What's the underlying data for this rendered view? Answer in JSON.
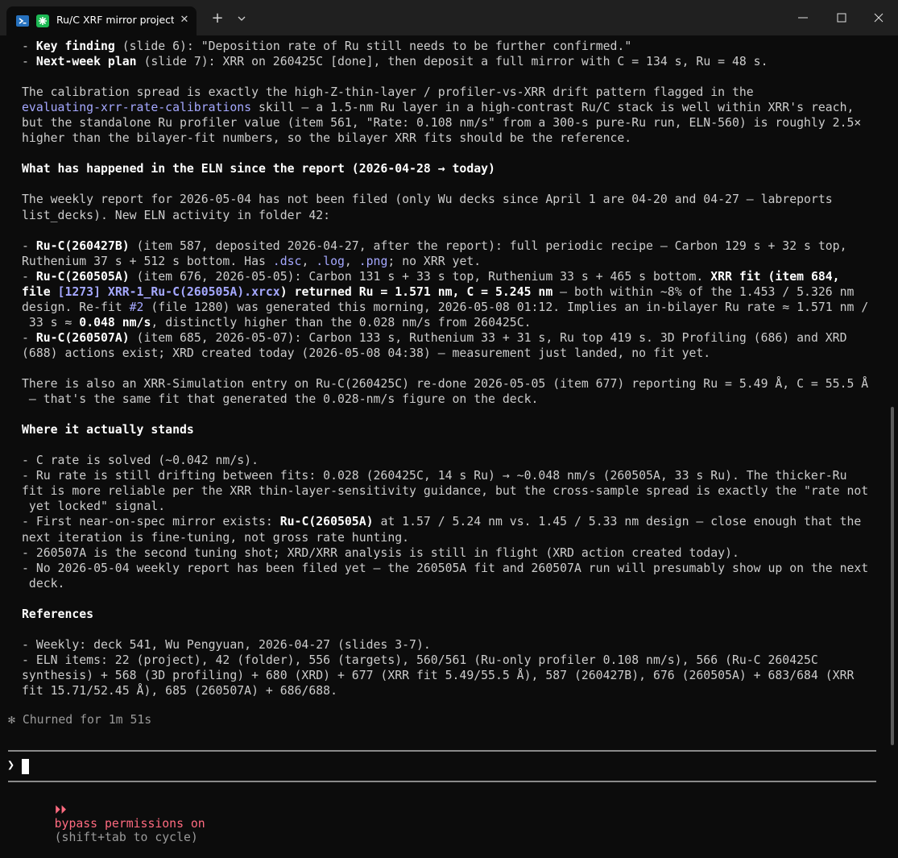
{
  "tab": {
    "title": "Ru/C XRF mirror project st",
    "close": "✕",
    "new_tab": "+"
  },
  "lines": [
    [
      [
        "- ",
        ""
      ],
      [
        "Key finding",
        "b"
      ],
      [
        " (slide 6): \"Deposition rate of Ru still needs to be further confirmed.\"",
        ""
      ]
    ],
    [
      [
        "- ",
        ""
      ],
      [
        "Next-week plan",
        "b"
      ],
      [
        " (slide 7): XRR on 260425C [done], then deposit a full mirror with C = 134 s, Ru = 48 s.",
        ""
      ]
    ],
    [],
    [
      [
        "The calibration spread is exactly the high-Z-thin-layer / profiler-vs-XRR drift pattern flagged in the",
        ""
      ]
    ],
    [
      [
        "evaluating-xrr-rate-calibrations",
        "link"
      ],
      [
        " skill — a 1.5-nm Ru layer in a high-contrast Ru/C stack is well within XRR's reach,",
        ""
      ]
    ],
    [
      [
        "but the standalone Ru profiler value (item 561, \"Rate: 0.108 nm/s\" from a 300-s pure-Ru run, ELN-560) is roughly 2.5×",
        ""
      ]
    ],
    [
      [
        "higher than the bilayer-fit numbers, so the bilayer XRR fits should be the reference.",
        ""
      ]
    ],
    [],
    [
      [
        "What has happened in the ELN since the report (2026-04-28 → today)",
        "b"
      ]
    ],
    [],
    [
      [
        "The weekly report for 2026-05-04 has not been filed (only Wu decks since April 1 are 04-20 and 04-27 — labreports",
        ""
      ]
    ],
    [
      [
        "list_decks). New ELN activity in folder 42:",
        ""
      ]
    ],
    [],
    [
      [
        "- ",
        ""
      ],
      [
        "Ru-C(260427B)",
        "b"
      ],
      [
        " (item 587, deposited 2026-04-27, after the report): full periodic recipe — Carbon 129 s + 32 s top,",
        ""
      ]
    ],
    [
      [
        "Ruthenium 37 s + 512 s bottom. Has ",
        ""
      ],
      [
        ".dsc",
        "code"
      ],
      [
        ", ",
        ""
      ],
      [
        ".log",
        "code"
      ],
      [
        ", ",
        ""
      ],
      [
        ".png",
        "code"
      ],
      [
        "; no XRR yet.",
        ""
      ]
    ],
    [
      [
        "- ",
        ""
      ],
      [
        "Ru-C(260505A)",
        "b"
      ],
      [
        " (item 676, 2026-05-05): Carbon 131 s + 33 s top, Ruthenium 33 s + 465 s bottom. ",
        ""
      ],
      [
        "XRR fit (item 684,",
        "b"
      ]
    ],
    [
      [
        "file ",
        "b"
      ],
      [
        "[1273] XRR-1_Ru-C(260505A).xrcx",
        "link b"
      ],
      [
        ") returned Ru = 1.571 nm, C = 5.245 nm",
        "b"
      ],
      [
        " — both within ~8% of the 1.453 / 5.326 nm",
        ""
      ]
    ],
    [
      [
        "design. Re-fit ",
        ""
      ],
      [
        "#2",
        "link"
      ],
      [
        " (file 1280) was generated this morning, 2026-05-08 01:12. Implies an in-bilayer Ru rate ≈ 1.571 nm /",
        ""
      ]
    ],
    [
      [
        " 33 s ≈ ",
        ""
      ],
      [
        "0.048 nm/s",
        "b"
      ],
      [
        ", distinctly higher than the 0.028 nm/s from 260425C.",
        ""
      ]
    ],
    [
      [
        "- ",
        ""
      ],
      [
        "Ru-C(260507A)",
        "b"
      ],
      [
        " (item 685, 2026-05-07): Carbon 133 s, Ruthenium 33 + 31 s, Ru top 419 s. 3D Profiling (686) and XRD",
        ""
      ]
    ],
    [
      [
        "(688) actions exist; XRD created today (2026-05-08 04:38) — measurement just landed, no fit yet.",
        ""
      ]
    ],
    [],
    [
      [
        "There is also an XRR-Simulation entry on Ru-C(260425C) re-done 2026-05-05 (item 677) reporting Ru = 5.49 Å, C = 55.5 Å",
        ""
      ]
    ],
    [
      [
        " — that's the same fit that generated the 0.028-nm/s figure on the deck.",
        ""
      ]
    ],
    [],
    [
      [
        "Where it actually stands",
        "b"
      ]
    ],
    [],
    [
      [
        "- C rate is solved (~0.042 nm/s).",
        ""
      ]
    ],
    [
      [
        "- Ru rate is still drifting between fits: 0.028 (260425C, 14 s Ru) → ~0.048 nm/s (260505A, 33 s Ru). The thicker-Ru",
        ""
      ]
    ],
    [
      [
        "fit is more reliable per the XRR thin-layer-sensitivity guidance, but the cross-sample spread is exactly the \"rate not",
        ""
      ]
    ],
    [
      [
        " yet locked\" signal.",
        ""
      ]
    ],
    [
      [
        "- First near-on-spec mirror exists: ",
        ""
      ],
      [
        "Ru-C(260505A)",
        "b"
      ],
      [
        " at 1.57 / 5.24 nm vs. 1.45 / 5.33 nm design — close enough that the",
        ""
      ]
    ],
    [
      [
        "next iteration is fine-tuning, not gross rate hunting.",
        ""
      ]
    ],
    [
      [
        "- 260507A is the second tuning shot; XRD/XRR analysis is still in flight (XRD action created today).",
        ""
      ]
    ],
    [
      [
        "- No 2026-05-04 weekly report has been filed yet — the 260505A fit and 260507A run will presumably show up on the next",
        ""
      ]
    ],
    [
      [
        " deck.",
        ""
      ]
    ],
    [],
    [
      [
        "References",
        "b"
      ]
    ],
    [],
    [
      [
        "- Weekly: deck 541, Wu Pengyuan, 2026-04-27 (slides 3-7).",
        ""
      ]
    ],
    [
      [
        "- ELN items: 22 (project), 42 (folder), 556 (targets), 560/561 (Ru-only profiler 0.108 nm/s), 566 (Ru-C 260425C",
        ""
      ]
    ],
    [
      [
        "synthesis) + 568 (3D profiling) + 680 (XRD) + 677 (XRR fit 5.49/55.5 Å), 587 (260427B), 676 (260505A) + 683/684 (XRR",
        ""
      ]
    ],
    [
      [
        "fit 15.71/52.45 Å), 685 (260507A) + 686/688.",
        ""
      ]
    ]
  ],
  "status_line": "✻ Churned for 1m 51s",
  "prompt": {
    "symbol": "❯",
    "value": ""
  },
  "mode": {
    "arrows": "⏵⏵",
    "label": "bypass permissions on",
    "hint": "(shift+tab to cycle)"
  },
  "colors": {
    "background": "#0c0c0c",
    "bold_text": "#ffffff",
    "link": "#a5a8ff",
    "mode_accent": "#ff6b80",
    "tab_icon": "#1db954"
  }
}
